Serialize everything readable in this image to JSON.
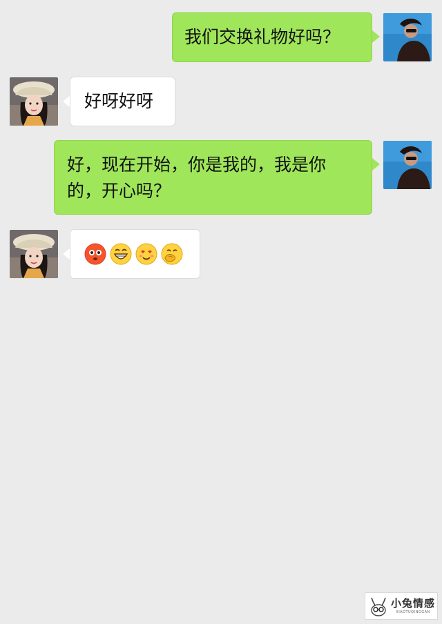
{
  "messages": [
    {
      "side": "right",
      "text": "我们交换礼物好吗？"
    },
    {
      "side": "left",
      "text": "好呀好呀"
    },
    {
      "side": "right",
      "lines": [
        "好，现在开始，你是我的，我是你",
        "的，开心吗？"
      ]
    },
    {
      "side": "left",
      "emojis": [
        "flushed-emoji",
        "grin-emoji",
        "smiling-heart-eyes-emoji",
        "facepalm-emoji"
      ]
    }
  ],
  "watermark": {
    "title": "小兔情感",
    "subtitle": "XIAOTUQINGGAN"
  },
  "colors": {
    "background": "#ebebeb",
    "my_bubble": "#9fe65a",
    "their_bubble": "#ffffff"
  }
}
